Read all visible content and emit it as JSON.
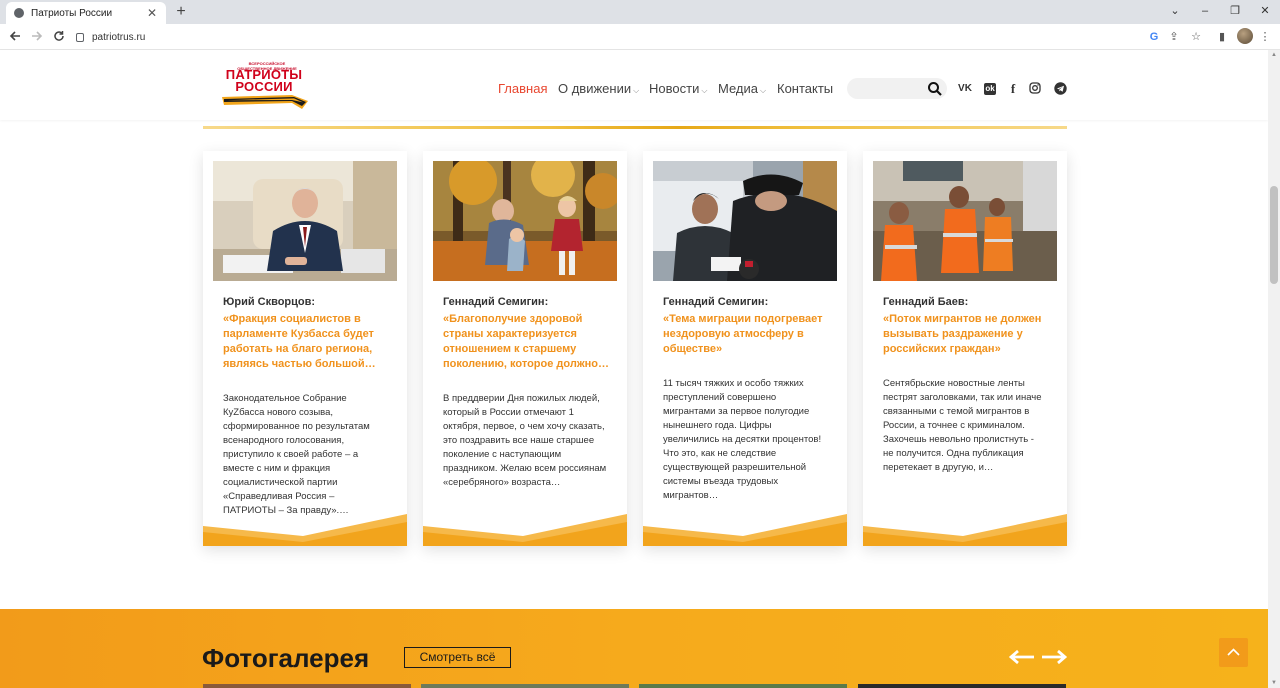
{
  "browser": {
    "tab_title": "Патриоты России",
    "tab_close": "✕",
    "new_tab": "+",
    "url": "patriotrus.ru",
    "window_controls": {
      "dropdown": "⌄",
      "minimize": "–",
      "maximize": "❐",
      "close": "✕"
    }
  },
  "site": {
    "logo_small": "ВСЕРОССИЙСКОЕ ОБЩЕСТВЕННОЕ ДВИЖЕНИЕ",
    "logo_big_1": "ПАТРИОТЫ",
    "logo_big_2": "РОССИИ",
    "nav": [
      {
        "label": "Главная"
      },
      {
        "label": "О движении"
      },
      {
        "label": "Новости"
      },
      {
        "label": "Медиа"
      },
      {
        "label": "Контакты"
      }
    ],
    "search_placeholder": "",
    "social": [
      "vk-icon",
      "odnoklassniki-icon",
      "facebook-icon",
      "instagram-icon",
      "telegram-icon"
    ],
    "social_glyphs": {
      "vk": "VK",
      "ok": "ok",
      "fb": "f"
    }
  },
  "cards": [
    {
      "author": "Юрий Скворцов:",
      "quote": "«Фракция социалистов в парламенте Кузбасса будет работать на благо региона, являясь частью большой…",
      "body": "Законодательное Собрание КуZбасса нового созыва, сформированное по результатам всенародного голосования, приступило к своей работе – а вместе с ним и фракция социалистической партии «Справедливая Россия – ПАТРИОТЫ – За правду».…"
    },
    {
      "author": "Геннадий Семигин:",
      "quote": "«Благополучие здоровой страны характеризуется отношением к старшему поколению, которое должно…",
      "body": "В преддверии Дня пожилых людей, который в России отмечают 1 октября,  первое, о чем хочу сказать, это поздравить все наше старшее поколение с наступающим праздником. Желаю всем россиянам «серебряного» возраста…"
    },
    {
      "author": "Геннадий Семигин:",
      "quote": "«Тема миграции подогревает нездоровую атмосферу в обществе»",
      "body": "11 тысяч тяжких и особо тяжких преступлений совершено мигрантами за первое полугодие нынешнего года. Цифры увеличились на десятки процентов! Что это, как не следствие существующей разрешительной системы въезда трудовых мигрантов…"
    },
    {
      "author": "Геннадий Баев:",
      "quote": "«Поток мигрантов не должен вызывать раздражение у российских граждан»",
      "body": "Сентябрьские новостные ленты пестрят заголовками, так или иначе связанными с темой мигрантов в России, а точнее с криминалом. Захочешь невольно пролистнуть - не получится. Одна публикация перетекает в другую, и…"
    }
  ],
  "gallery": {
    "title": "Фотогалерея",
    "button": "Смотреть всё"
  },
  "colors": {
    "accent": "#f0921d",
    "nav_active": "#e8462f",
    "gallery_bg": "#f6aa1c",
    "logo_red": "#d0021b"
  }
}
